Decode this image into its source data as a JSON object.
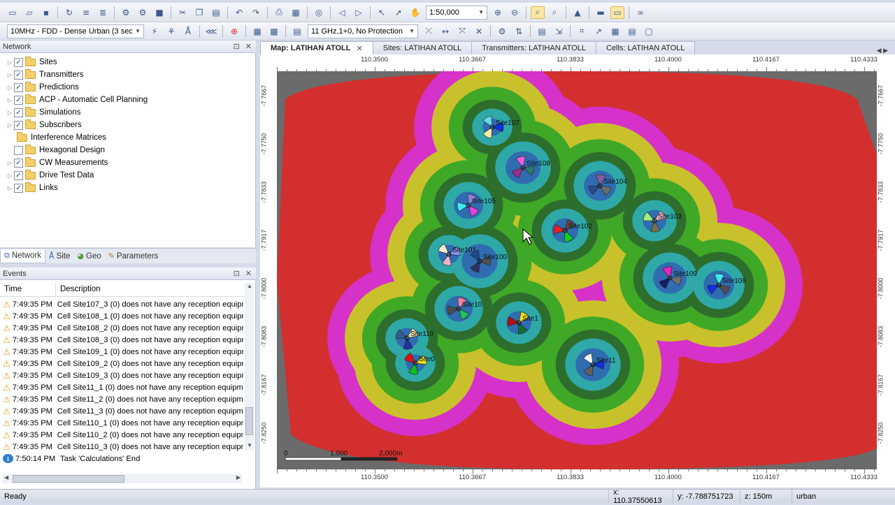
{
  "toolbar1": {
    "zoom_scale": "1:50,000"
  },
  "toolbar2": {
    "network_config": "10MHz - FDD - Dense Urban (3 sec",
    "frequency_band": "11 GHz,1+0, No Protection"
  },
  "network_panel": {
    "title": "Network",
    "items": [
      {
        "label": "Sites",
        "expandable": true,
        "checked": true
      },
      {
        "label": "Transmitters",
        "expandable": true,
        "checked": true
      },
      {
        "label": "Predictions",
        "expandable": true,
        "checked": true
      },
      {
        "label": "ACP - Automatic Cell Planning",
        "expandable": true,
        "checked": true
      },
      {
        "label": "Simulations",
        "expandable": true,
        "checked": true
      },
      {
        "label": "Subscribers",
        "expandable": true,
        "checked": true
      },
      {
        "label": "Interference Matrices",
        "expandable": false,
        "checked": null
      },
      {
        "label": "Hexagonal Design",
        "expandable": false,
        "checked": false
      },
      {
        "label": "CW Measurements",
        "expandable": true,
        "checked": true
      },
      {
        "label": "Drive Test Data",
        "expandable": true,
        "checked": true
      },
      {
        "label": "Links",
        "expandable": true,
        "checked": true
      }
    ]
  },
  "panel_tabs": [
    "Network",
    "Site",
    "Geo",
    "Parameters"
  ],
  "events_panel": {
    "title": "Events",
    "col_time": "Time",
    "col_desc": "Description",
    "rows": [
      {
        "type": "warning",
        "time": "7:49:35 PM",
        "text": "Cell Site107_3 (0) does not have any reception equipment"
      },
      {
        "type": "warning",
        "time": "7:49:35 PM",
        "text": "Cell Site108_1 (0) does not have any reception equipment"
      },
      {
        "type": "warning",
        "time": "7:49:35 PM",
        "text": "Cell Site108_2 (0) does not have any reception equipment"
      },
      {
        "type": "warning",
        "time": "7:49:35 PM",
        "text": "Cell Site108_3 (0) does not have any reception equipment"
      },
      {
        "type": "warning",
        "time": "7:49:35 PM",
        "text": "Cell Site109_1 (0) does not have any reception equipment"
      },
      {
        "type": "warning",
        "time": "7:49:35 PM",
        "text": "Cell Site109_2 (0) does not have any reception equipment"
      },
      {
        "type": "warning",
        "time": "7:49:35 PM",
        "text": "Cell Site109_3 (0) does not have any reception equipment"
      },
      {
        "type": "warning",
        "time": "7:49:35 PM",
        "text": "Cell Site11_1 (0) does not have any reception equipment"
      },
      {
        "type": "warning",
        "time": "7:49:35 PM",
        "text": "Cell Site11_2 (0) does not have any reception equipment"
      },
      {
        "type": "warning",
        "time": "7:49:35 PM",
        "text": "Cell Site11_3 (0) does not have any reception equipment"
      },
      {
        "type": "warning",
        "time": "7:49:35 PM",
        "text": "Cell Site110_1 (0) does not have any reception equipment"
      },
      {
        "type": "warning",
        "time": "7:49:35 PM",
        "text": "Cell Site110_2 (0) does not have any reception equipment"
      },
      {
        "type": "warning",
        "time": "7:49:35 PM",
        "text": "Cell Site110_3 (0) does not have any reception equipment"
      },
      {
        "type": "info",
        "time": "7:50:14 PM",
        "text": "Task 'Calculations' End"
      }
    ]
  },
  "doc_tabs": [
    {
      "label": "Map: LATIHAN ATOLL",
      "active": true,
      "closable": true
    },
    {
      "label": "Sites: LATIHAN ATOLL",
      "active": false,
      "closable": false
    },
    {
      "label": "Transmitters: LATIHAN ATOLL",
      "active": false,
      "closable": false
    },
    {
      "label": "Cells: LATIHAN ATOLL",
      "active": false,
      "closable": false
    }
  ],
  "map": {
    "x_ticks": [
      "110.3500",
      "110.3667",
      "110.3833",
      "110.4000",
      "110.4167",
      "110.4333"
    ],
    "y_ticks": [
      "-7.7667",
      "-7.7750",
      "-7.7833",
      "-7.7917",
      "-7.8000",
      "-7.8083",
      "-7.8167",
      "-7.8250"
    ],
    "scale_labels": [
      "0",
      "1,000",
      "2,000m"
    ],
    "colors": {
      "outer": "#d32f2f",
      "magenta": "#d631c9",
      "yellow": "#c9c12b",
      "green": "#3fa827",
      "darkgreen": "#2d6e2d",
      "cyan": "#2fa8a8",
      "blue": "#2f6cb0",
      "gray": "#6b6b6b"
    },
    "sites": [
      {
        "name": "Site107"
      },
      {
        "name": "Site108"
      },
      {
        "name": "Site104"
      },
      {
        "name": "Site105"
      },
      {
        "name": "Site102"
      },
      {
        "name": "Site103"
      },
      {
        "name": "Site101"
      },
      {
        "name": "Site100"
      },
      {
        "name": "Site109"
      },
      {
        "name": "Site106"
      },
      {
        "name": "Site10"
      },
      {
        "name": "Site1"
      },
      {
        "name": "Site110"
      },
      {
        "name": "Site0"
      },
      {
        "name": "Site11"
      }
    ]
  },
  "status_bar": {
    "status": "Ready",
    "x_coord": "x: 110.37550613",
    "y_coord": "y: -7.788751723",
    "z_coord": "z: 150m",
    "clutter": "urban"
  }
}
